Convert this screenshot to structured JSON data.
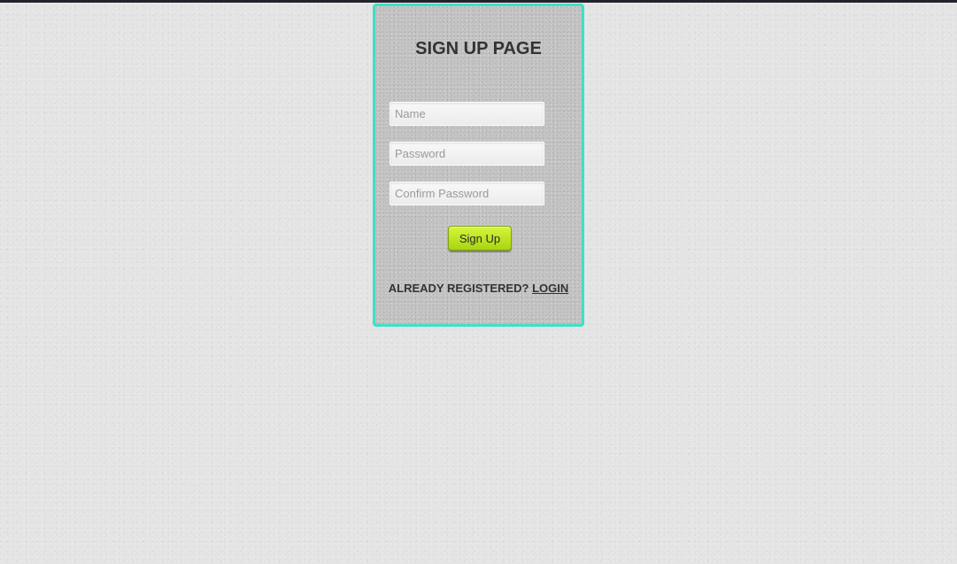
{
  "page": {
    "title": "SIGN UP PAGE"
  },
  "form": {
    "name_placeholder": "Name",
    "password_placeholder": "Password",
    "confirm_password_placeholder": "Confirm Password",
    "submit_label": "Sign Up"
  },
  "footer": {
    "prompt": "ALREADY REGISTERED?",
    "login_label": "LOGIN"
  },
  "colors": {
    "card_border": "#3fe0c5",
    "button": "#b8e41d"
  }
}
